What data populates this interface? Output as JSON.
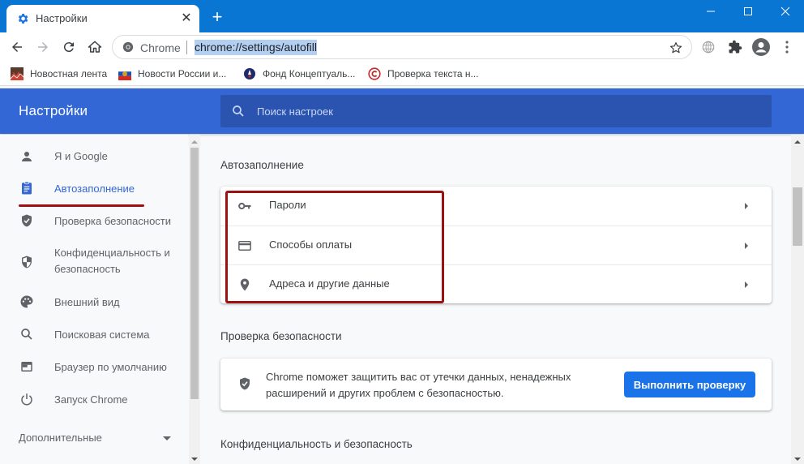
{
  "window": {
    "tab_title": "Настройки",
    "tab_icon": "gear-icon",
    "new_tab_label": "+",
    "controls": [
      "minimize",
      "maximize",
      "close"
    ]
  },
  "toolbar": {
    "site_label": "Chrome",
    "url": "chrome://settings/autofill",
    "icons": [
      "back-icon",
      "forward-icon",
      "reload-icon",
      "home-icon",
      "star-icon",
      "globe-icon",
      "extensions-icon",
      "profile-icon",
      "menu-icon"
    ]
  },
  "bookmarks": [
    {
      "label": "Новостная лента",
      "icon": "news-feed-icon"
    },
    {
      "label": "Новости России и...",
      "icon": "russia-flag-icon"
    },
    {
      "label": "Фонд Концептуаль...",
      "icon": "fund-icon"
    },
    {
      "label": "Проверка текста н...",
      "icon": "copyright-icon"
    }
  ],
  "header": {
    "title": "Настройки",
    "search_placeholder": "Поиск настроек"
  },
  "sidebar": {
    "items": [
      {
        "label": "Я и Google",
        "icon": "person-icon",
        "active": false
      },
      {
        "label": "Автозаполнение",
        "icon": "clipboard-icon",
        "active": true
      },
      {
        "label": "Проверка безопасности",
        "icon": "shield-check-icon",
        "active": false
      },
      {
        "label": "Конфиденциальность и безопасность",
        "label_line1": "Конфиденциальность и",
        "label_line2": "безопасность",
        "icon": "shield-half-icon",
        "active": false
      },
      {
        "label": "Внешний вид",
        "icon": "palette-icon",
        "active": false
      },
      {
        "label": "Поисковая система",
        "icon": "search-icon",
        "active": false
      },
      {
        "label": "Браузер по умолчанию",
        "icon": "browser-window-icon",
        "active": false
      },
      {
        "label": "Запуск Chrome",
        "icon": "power-icon",
        "active": false
      }
    ],
    "advanced_label": "Дополнительные"
  },
  "main": {
    "autofill": {
      "title": "Автозаполнение",
      "rows": [
        {
          "label": "Пароли",
          "icon": "key-icon"
        },
        {
          "label": "Способы оплаты",
          "icon": "credit-card-icon"
        },
        {
          "label": "Адреса и другие данные",
          "icon": "location-pin-icon"
        }
      ]
    },
    "safety": {
      "title": "Проверка безопасности",
      "text": "Chrome поможет защитить вас от утечки данных, ненадежных расширений и других проблем с безопасностью.",
      "button_label": "Выполнить проверку"
    },
    "privacy": {
      "title": "Конфиденциальность и безопасность"
    }
  },
  "colors": {
    "titlebar": "#0a76d4",
    "header": "#3367d6",
    "search_bg": "#2a54b0",
    "accent": "#1a73e8",
    "highlight": "#9e1111"
  }
}
